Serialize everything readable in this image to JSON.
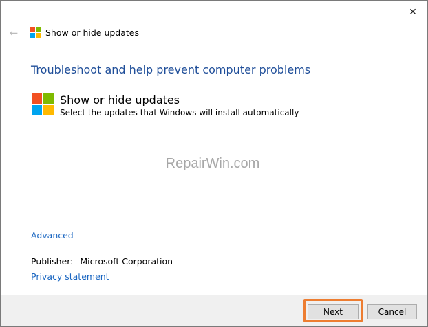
{
  "window": {
    "title": "Show or hide updates",
    "close_glyph": "✕",
    "back_glyph": "←"
  },
  "content": {
    "heading": "Troubleshoot and help prevent computer problems",
    "package_name": "Show or hide updates",
    "package_description": "Select the updates that Windows will install automatically",
    "watermark": "RepairWin.com",
    "advanced_link": "Advanced",
    "publisher_label": "Publisher:",
    "publisher_value": "Microsoft Corporation",
    "privacy_link": "Privacy statement"
  },
  "footer": {
    "next_label": "Next",
    "cancel_label": "Cancel"
  },
  "colors": {
    "logo_red": "#f25022",
    "logo_green": "#7fba00",
    "logo_blue": "#00a4ef",
    "logo_yellow": "#ffb900",
    "heading_blue": "#1f4e99",
    "link_blue": "#1a66c1",
    "highlight_orange": "#ed7d31"
  },
  "icons": {
    "app_logo": "windows-logo-icon",
    "back": "back-arrow-icon",
    "close": "close-icon"
  }
}
